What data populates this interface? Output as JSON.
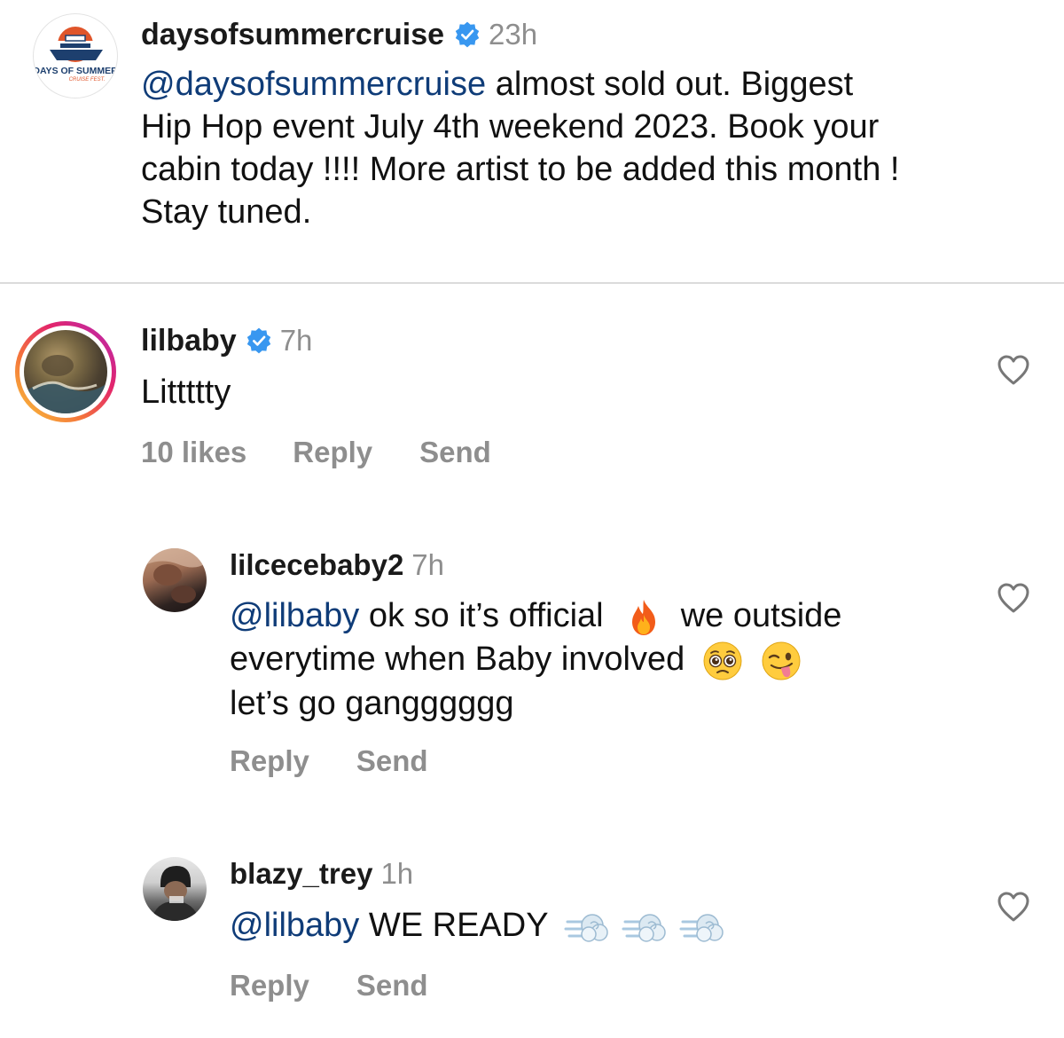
{
  "caption": {
    "username": "daysofsummercruise",
    "time": "23h",
    "logo_text": {
      "top": "DAYS OF SUMMER",
      "sub": "CRUISE FEST."
    },
    "mention": "@daysofsummercruise",
    "line1": "almost sold out.  Biggest",
    "line2": "Hip Hop event July 4th weekend 2023.  Book your",
    "line3": "cabin today !!!! More artist to be added this month !",
    "line4": "Stay tuned."
  },
  "comments": [
    {
      "username": "lilbaby",
      "time": "7h",
      "text": "Littttty",
      "likes": "10 likes",
      "reply": "Reply",
      "send": "Send"
    },
    {
      "username": "lilcecebaby2",
      "time": "7h",
      "mention": "@lilbaby",
      "line1": "ok so it’s official",
      "line1b": "we outside",
      "line2": "everytime when Baby involved",
      "line3": "let’s go gangggggg",
      "reply": "Reply",
      "send": "Send"
    },
    {
      "username": "blazy_trey",
      "time": "1h",
      "mention": "@lilbaby",
      "text": "WE READY",
      "reply": "Reply",
      "send": "Send"
    }
  ],
  "icons": {
    "verified": "verified-badge-icon",
    "like": "heart-outline-icon",
    "emoji_fire": "fire-emoji",
    "emoji_pleading": "pleading-face-emoji",
    "emoji_wink_tongue": "winking-tongue-emoji",
    "emoji_dash": "dashing-away-emoji"
  },
  "colors": {
    "mention": "#0f3c78",
    "muted": "#8e8e8e",
    "verified": "#3897f0"
  }
}
